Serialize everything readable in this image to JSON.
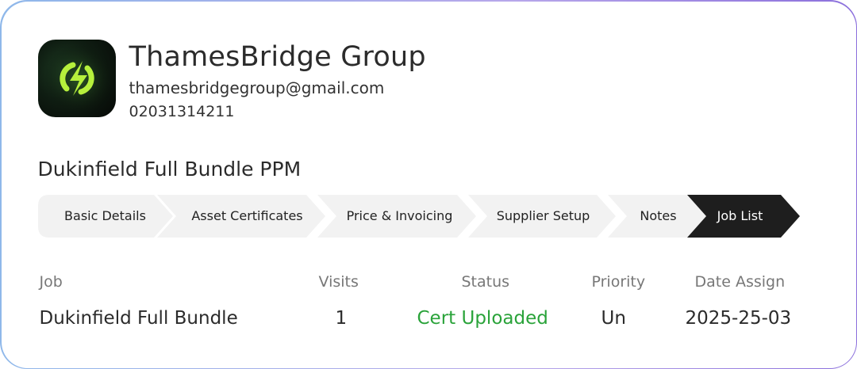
{
  "company": {
    "name": "ThamesBridge Group",
    "email": "thamesbridgegroup@gmail.com",
    "phone": "02031314211",
    "logo_icon": "lightning-refresh-icon",
    "logo_accent": "#b6f03c"
  },
  "project": {
    "title": "Dukinfield Full Bundle PPM"
  },
  "tabs": [
    {
      "label": "Basic Details",
      "active": false
    },
    {
      "label": "Asset Certificates",
      "active": false
    },
    {
      "label": "Price & Invoicing",
      "active": false
    },
    {
      "label": "Supplier Setup",
      "active": false
    },
    {
      "label": "Notes",
      "active": false
    },
    {
      "label": "Job List",
      "active": true
    }
  ],
  "colors": {
    "tab_inactive": "#f2f2f2",
    "tab_active": "#1e1e1e",
    "status_green": "#2aa33a"
  },
  "table": {
    "headers": [
      "Job",
      "Visits",
      "Status",
      "Priority",
      "Date Assign"
    ],
    "rows": [
      {
        "job": "Dukinfield Full Bundle",
        "visits": "1",
        "status": "Cert Uploaded",
        "priority": "Un",
        "date": "2025-25-03"
      }
    ]
  }
}
